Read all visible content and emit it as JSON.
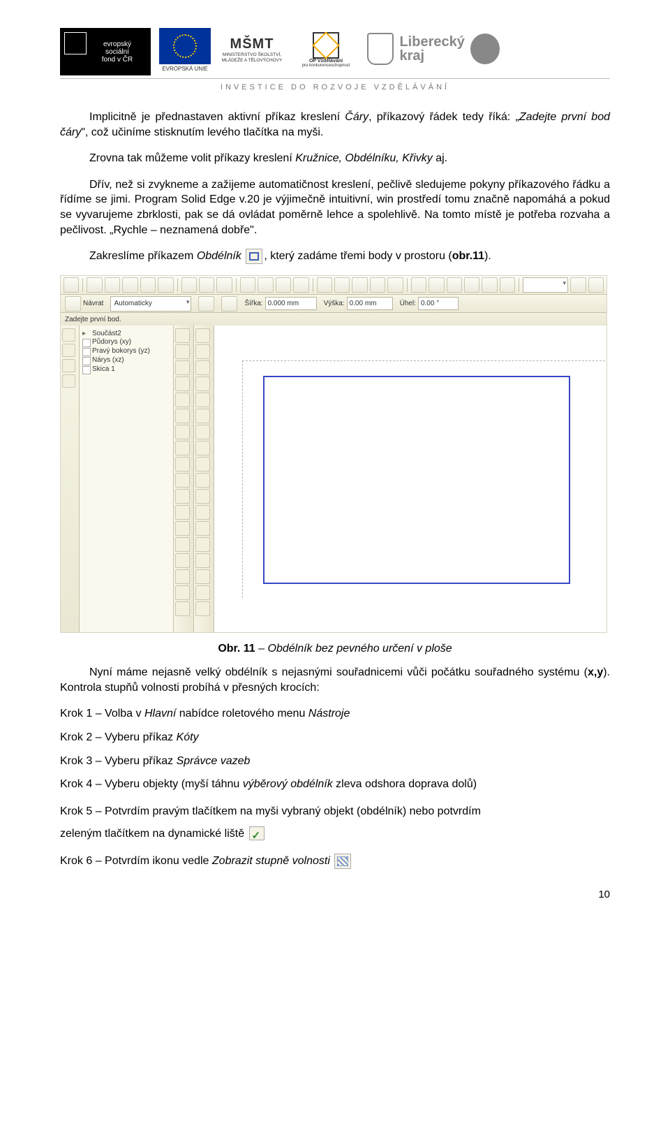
{
  "header": {
    "tagline": "INVESTICE DO ROZVOJE VZDĚLÁVÁNÍ",
    "logos": {
      "esf": {
        "line1": "evropský",
        "line2": "sociální",
        "line3": "fond v ČR",
        "eu": "EVROPSKÁ UNIE"
      },
      "msmt": {
        "mark": "MŠMT",
        "sub": "MINISTERSTVO ŠKOLSTVÍ,\nMLÁDEŽE A TĚLOVÝCHOVY"
      },
      "opvk": {
        "line1": "OP Vzdělávání",
        "line2": "pro konkurenceschopnost"
      },
      "kraj": {
        "top": "Liberecký",
        "bottom": "kraj"
      }
    }
  },
  "p1a": "Implicitně je přednastaven aktivní příkaz kreslení ",
  "p1b": "Čáry",
  "p1c": ", příkazový řádek tedy říká: „",
  "p1d": "Zadejte první bod čáry",
  "p1e": "\", což učiníme stisknutím levého tlačítka na myši.",
  "p2a": "Zrovna tak můžeme volit příkazy kreslení ",
  "p2b": "Kružnice, Obdélníku, Křivky",
  "p2c": " aj.",
  "p3": "Dřív, než si zvykneme a zažijeme automatičnost kreslení, pečlivě sledujeme pokyny příkazového řádku a řídíme se jimi. Program Solid Edge v.20 je výjimečně intuitivní, win prostředí tomu značně napomáhá a pokud se vyvarujeme zbrklosti, pak se dá ovládat poměrně lehce a spolehlivě. Na tomto místě je potřeba rozvaha a pečlivost. „Rychle – neznamená dobře\".",
  "p4a": "Zakreslíme příkazem ",
  "p4b": "Obdélník",
  "p4c": ", který zadáme třemi body v prostoru (",
  "p4d": "obr.11",
  "p4e": ").",
  "app": {
    "toolbar2": {
      "navrat": "Návrat",
      "auto_label": "",
      "auto_value": "Automaticky",
      "sirka_label": "Šířka:",
      "sirka_value": "0.000 mm",
      "vyska_label": "Výška:",
      "vyska_value": "0.00 mm",
      "uhel_label": "Úhel:",
      "uhel_value": "0.00 °"
    },
    "prompt": "Zadejte první bod.",
    "tree": {
      "root": "Součást2",
      "items": [
        "Půdorys (xy)",
        "Pravý bokorys (yz)",
        "Nárys (xz)",
        "Skica 1"
      ]
    }
  },
  "caption_a": "Obr. 11",
  "caption_b": " – Obdélník bez pevného určení v ploše",
  "p5a": "Nyní máme nejasně velký obdélník s nejasnými souřadnicemi vůči počátku souřadného systému (",
  "p5b": "x,y",
  "p5c": "). Kontrola stupňů volnosti probíhá v přesných krocích:",
  "steps": {
    "s1a": "Krok 1 – Volba v ",
    "s1b": "Hlavní",
    "s1c": " nabídce roletového menu ",
    "s1d": "Nástroje",
    "s2a": "Krok 2 – Vyberu příkaz ",
    "s2b": "Kóty",
    "s3a": "Krok 3 – Vyberu příkaz ",
    "s3b": "Správce vazeb",
    "s4a": "Krok 4 – Vyberu objekty (myší táhnu ",
    "s4b": "výběrový obdélník",
    "s4c": " zleva odshora doprava dolů)",
    "s5a": "Krok 5 – Potvrdím pravým tlačítkem na myši vybraný objekt (obdélník) nebo potvrdím",
    "s5b": "zeleným tlačítkem na dynamické liště ",
    "s6a": "Krok 6 – Potvrdím ikonu vedle ",
    "s6b": "Zobrazit stupně volnosti"
  },
  "page_number": "10"
}
